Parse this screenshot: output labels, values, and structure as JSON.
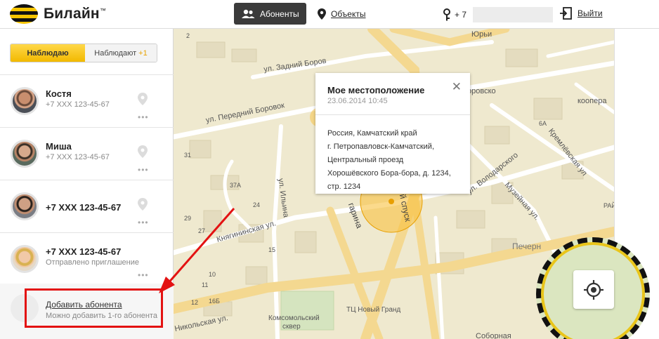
{
  "header": {
    "logo_text": "Билайн",
    "logo_mark": "™",
    "nav": {
      "subscribers_label": "Абоненты",
      "objects_label": "Объекты"
    },
    "user_phone_prefix": "+ 7",
    "logout_label": "Выйти"
  },
  "sidebar": {
    "toggle": {
      "watching_label": "Наблюдаю",
      "watched_by_label": "Наблюдают",
      "watched_by_count": "+1"
    },
    "contacts": [
      {
        "name": "Костя",
        "phone": "+7 XXX 123-45-67"
      },
      {
        "name": "Миша",
        "phone": "+7 XXX 123-45-67"
      },
      {
        "name": "+7 XXX 123-45-67",
        "phone": ""
      },
      {
        "name": "+7 XXX 123-45-67",
        "phone": "Отправлено приглашение"
      }
    ],
    "add": {
      "title": "Добавить абонента",
      "subtitle": "Можно добавить 1-го абонента"
    }
  },
  "popup": {
    "title": "Мое местоположение",
    "date": "23.06.2014 10:45",
    "close_glyph": "✕",
    "address_lines": [
      "Россия, Камчатский край",
      "г. Петропавловск-Камчатский,",
      "Центральный проезд",
      "Хорошёвского Бора-бора, д. 1234,",
      "стр. 1234"
    ]
  },
  "map": {
    "labels": {
      "zadniy": "ул. Задний Боров",
      "peredniy": "ул. Передний Боровок",
      "ilyina": "ул. Ильина",
      "knyaginin": "Княгининская ул.",
      "nikolskaya": "я Никольская ул.",
      "garina": "гарина",
      "spusk": "й спуск",
      "volodar": "ул. Володарского",
      "kreml": "Кремлёвская ул",
      "muzey": "Музейная ул.",
      "kooper": "коопера",
      "borov": "оровско",
      "yury": "Юрьи",
      "pechern": "Печерн",
      "komsomol1": "Комсомольский",
      "komsomol2": "сквер",
      "tc": "ТЦ Новый Гранд",
      "sobor": "Соборная",
      "n2": "2",
      "n10": "10",
      "n11": "11",
      "n12": "12",
      "n15": "15",
      "n16": "16",
      "n165": "16Б",
      "n24": "24",
      "n27": "27",
      "n29": "29",
      "n31": "31",
      "n37a": "37А",
      "n6a": "6А",
      "raj": "РАЙ"
    }
  },
  "colors": {
    "accent_yellow": "#f2b900",
    "header_dark": "#3b3b3b",
    "annotation_red": "#e31212",
    "map_road": "#f4d890",
    "map_bg": "#efe9cf"
  }
}
